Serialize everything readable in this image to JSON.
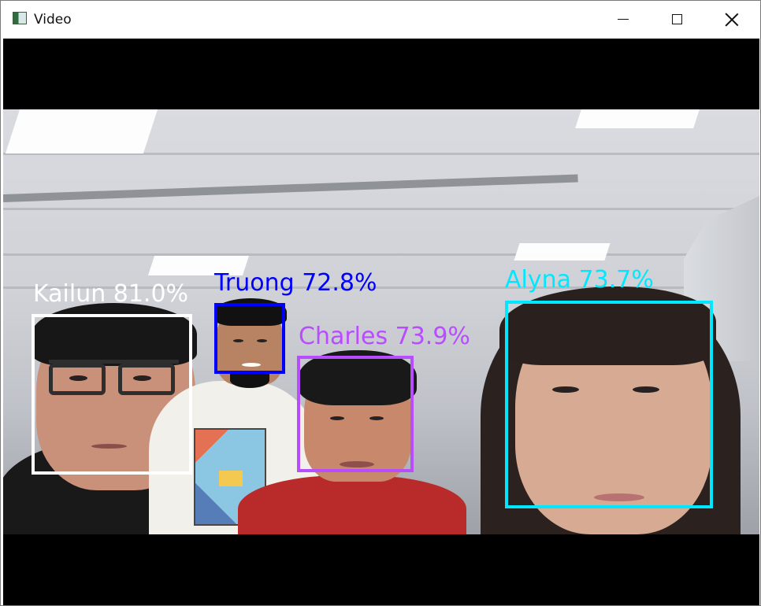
{
  "window": {
    "title": "Video",
    "icon": "app-window-icon",
    "controls": {
      "minimize": "minimize-icon",
      "maximize": "maximize-icon",
      "close": "close-icon"
    }
  },
  "video": {
    "detections": [
      {
        "name": "Kailun",
        "confidence": "81.0%",
        "label": "Kailun 81.0%",
        "color": "#ffffff"
      },
      {
        "name": "Truong",
        "confidence": "72.8%",
        "label": "Truong 72.8%",
        "color": "#0000ff"
      },
      {
        "name": "Charles",
        "confidence": "73.9%",
        "label": "Charles 73.9%",
        "color": "#b84cff"
      },
      {
        "name": "Alyna",
        "confidence": "73.7%",
        "label": "Alyna 73.7%",
        "color": "#00e8ff"
      }
    ]
  }
}
